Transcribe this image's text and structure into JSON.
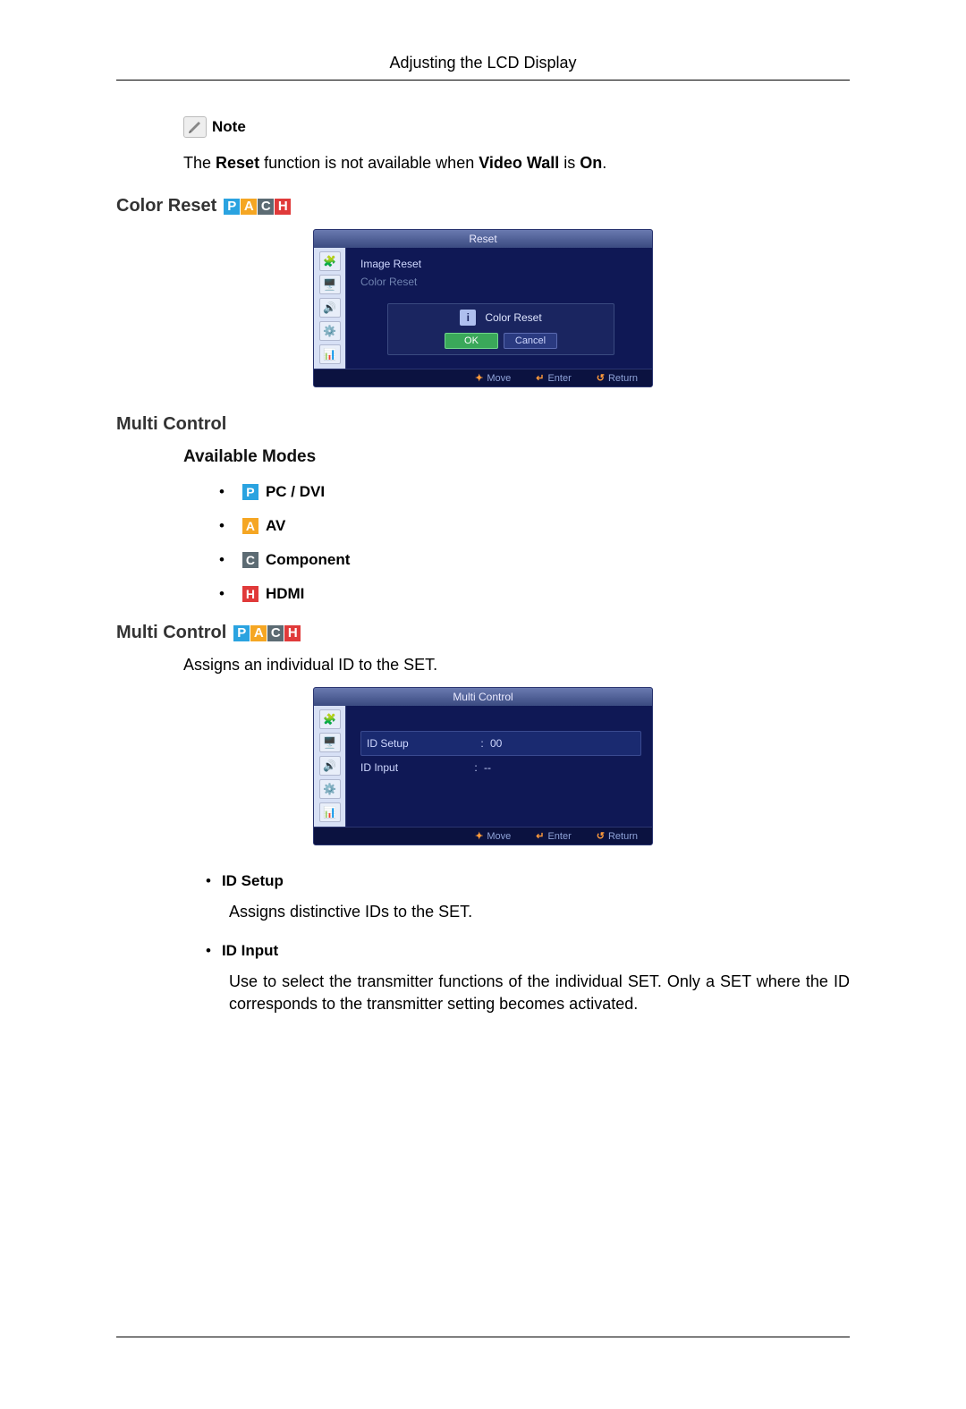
{
  "header": {
    "title": "Adjusting the LCD Display"
  },
  "note": {
    "label": "Note",
    "text_parts": {
      "pre": "The ",
      "reset": "Reset",
      "mid": " function is not available when ",
      "videowall": "Video Wall",
      "post": " is ",
      "on": "On",
      "end": "."
    }
  },
  "badges": {
    "p": "P",
    "a": "A",
    "c": "C",
    "h": "H"
  },
  "sections": {
    "color_reset": "Color Reset",
    "multi_control_h": "Multi Control",
    "available_modes": "Available Modes",
    "multi_control_h2": "Multi Control",
    "assigns_text": "Assigns an individual ID to the SET."
  },
  "modes": {
    "pc_dvi": "PC / DVI",
    "av": "AV",
    "component": "Component",
    "hdmi": "HDMI"
  },
  "osd_reset": {
    "title": "Reset",
    "item1": "Image Reset",
    "item2": "Color Reset",
    "dialog_title": "Color Reset",
    "ok": "OK",
    "cancel": "Cancel"
  },
  "osd_multi": {
    "title": "Multi Control",
    "row1_label": "ID Setup",
    "row1_value": "00",
    "row2_label": "ID Input",
    "row2_value": "--"
  },
  "osd_footer": {
    "move": "Move",
    "enter": "Enter",
    "return": "Return"
  },
  "defs": {
    "id_setup": {
      "term": "ID Setup",
      "body": "Assigns distinctive IDs to the SET."
    },
    "id_input": {
      "term": "ID Input",
      "body": "Use to select the transmitter functions of the individual SET. Only a SET where the ID corresponds to the transmitter setting becomes activated."
    }
  }
}
